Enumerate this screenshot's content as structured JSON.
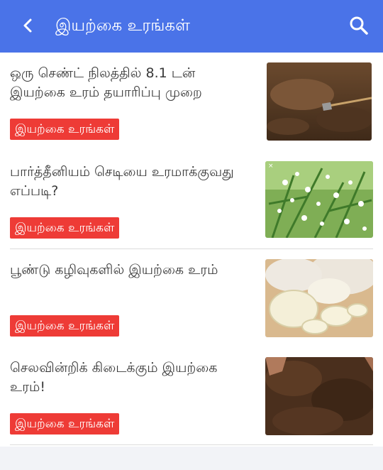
{
  "app_bar": {
    "title": "இயற்கை உரங்கள்",
    "back_icon": "arrow-back-icon",
    "search_icon": "search-icon",
    "color": "#4a73e8"
  },
  "articles": [
    {
      "headline": "ஒரு செண்ட் நிலத்தில் 8.1 டன் இயற்கை உரம் தயாரிப்பு முறை",
      "tag": "இயற்கை உரங்கள்",
      "image": "soil-with-shovel"
    },
    {
      "headline": "பார்த்தீனியம் செடியை உரமாக்குவது எப்படி?",
      "tag": "இயற்கை உரங்கள்",
      "image": "parthenium-plant",
      "image_badge": "×"
    },
    {
      "headline": "பூண்டு கழிவுகளில் இயற்கை உரம்",
      "tag": "இயற்கை உரங்கள்",
      "image": "garlic-cloves"
    },
    {
      "headline": "செலவின்றிக் கிடைக்கும் இயற்கை உரம்!",
      "tag": "இயற்கை உரங்கள்",
      "image": "compost-soil"
    }
  ],
  "colors": {
    "tag_background": "#ee3b36",
    "tag_text": "#ffffff",
    "headline_text": "#3a3a3a"
  }
}
